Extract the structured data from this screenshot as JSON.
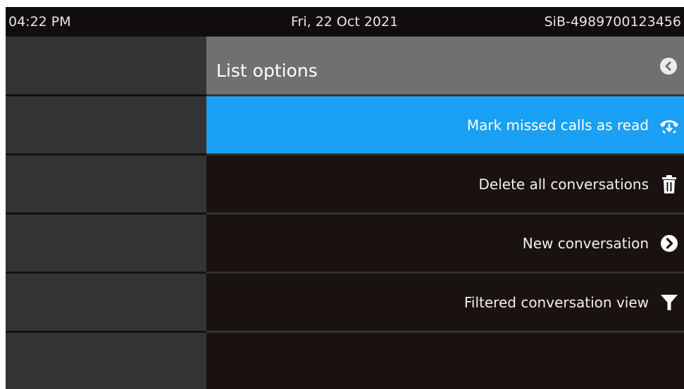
{
  "status_bar": {
    "time": "04:22 PM",
    "date": "Fri, 22 Oct 2021",
    "device_id": "SiB-4989700123456"
  },
  "menu": {
    "title": "List options",
    "back_icon": "chevron-left-circle-icon",
    "options": [
      {
        "label": "Mark missed calls as read",
        "icon": "missed-call-phone-icon",
        "selected": true
      },
      {
        "label": "Delete all conversations",
        "icon": "trash-icon",
        "selected": false
      },
      {
        "label": "New conversation",
        "icon": "chevron-right-circle-icon",
        "selected": false
      },
      {
        "label": "Filtered conversation view",
        "icon": "filter-funnel-icon",
        "selected": false
      }
    ]
  },
  "colors": {
    "selected_row": "#1aa0f5",
    "header_bg": "#707070",
    "list_bg": "#1a1111",
    "left_panel_bg": "#333333"
  }
}
